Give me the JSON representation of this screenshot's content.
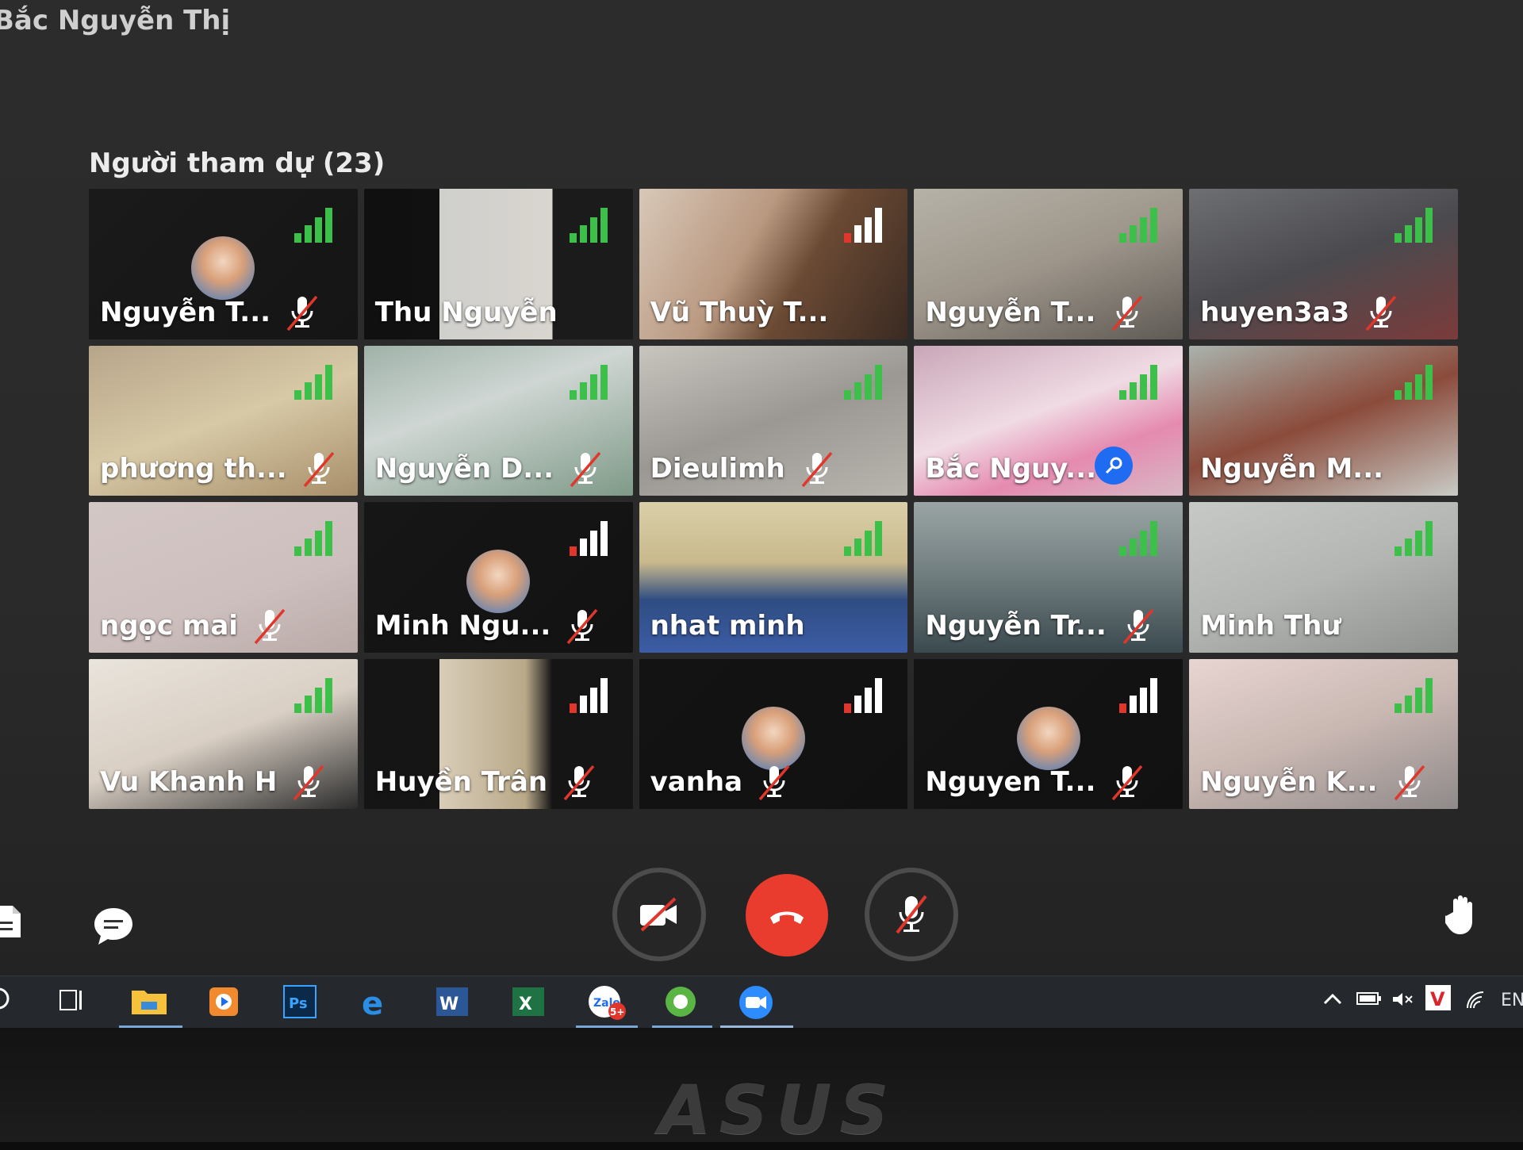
{
  "window": {
    "title": "Bắc Nguyễn Thị"
  },
  "participants": {
    "heading": "Người tham dự (23)",
    "tiles": [
      {
        "name": "Nguyễn T...",
        "muted": true,
        "avatar": true
      },
      {
        "name": "Thu Nguyễn",
        "muted": false
      },
      {
        "name": "Vũ Thuỳ T...",
        "muted": false
      },
      {
        "name": "Nguyễn T...",
        "muted": true
      },
      {
        "name": "huyen3a3",
        "muted": true
      },
      {
        "name": "phương th...",
        "muted": true
      },
      {
        "name": "Nguyễn D...",
        "muted": true
      },
      {
        "name": "Dieulimh",
        "muted": true
      },
      {
        "name": "Bắc Nguy...",
        "muted": false,
        "host": true
      },
      {
        "name": "Nguyễn M...",
        "muted": false
      },
      {
        "name": "ngọc mai",
        "muted": true
      },
      {
        "name": "Minh Ngu...",
        "muted": true,
        "avatar": true
      },
      {
        "name": "nhat minh",
        "muted": false
      },
      {
        "name": "Nguyễn Tr...",
        "muted": true
      },
      {
        "name": "Minh Thư",
        "muted": false
      },
      {
        "name": "Vu Khanh H",
        "muted": true
      },
      {
        "name": "Huyền Trân",
        "muted": true
      },
      {
        "name": "vanha",
        "muted": true,
        "avatar": true
      },
      {
        "name": "Nguyen T...",
        "muted": true,
        "avatar": true
      },
      {
        "name": "Nguyễn K...",
        "muted": true
      }
    ]
  },
  "controls": {
    "camera_icon": "camera-off-icon",
    "end_call_icon": "phone-hangup-icon",
    "mic_icon": "mic-off-icon",
    "chat_icon": "chat-bubble-icon",
    "hand_icon": "raise-hand-icon"
  },
  "taskbar": {
    "language": "EN",
    "items": [
      "search-icon",
      "task-view-icon",
      "file-explorer-icon",
      "media-player-icon",
      "photoshop-icon",
      "edge-icon",
      "word-icon",
      "excel-icon",
      "zalo-icon",
      "coccoc-icon",
      "zoom-icon"
    ],
    "zalo_badge": "5+"
  },
  "colors": {
    "accent": "#1f6cf2",
    "end_call": "#ea3b2f",
    "signal_green": "#3cc04a",
    "muted_red": "#e0362c"
  },
  "brand": "ASUS"
}
